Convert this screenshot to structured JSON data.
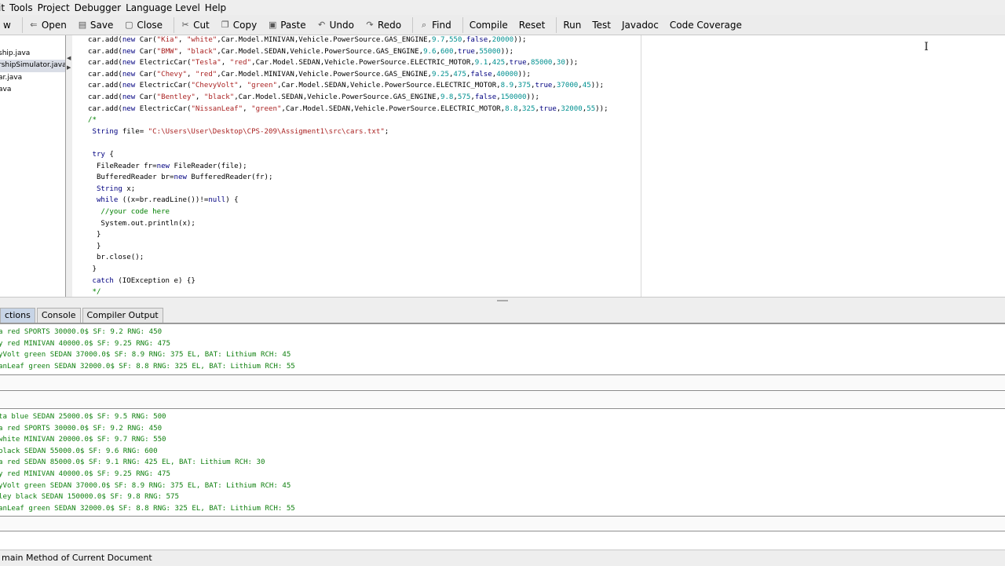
{
  "menubar": [
    "it",
    "Tools",
    "Project",
    "Debugger",
    "Language Level",
    "Help"
  ],
  "toolbar": [
    {
      "icon": "",
      "label": "w"
    },
    {
      "icon": "open-icon",
      "glyph": "⇐",
      "label": "Open"
    },
    {
      "icon": "save-icon",
      "glyph": "▤",
      "label": "Save"
    },
    {
      "icon": "close-file-icon",
      "glyph": "▢",
      "label": "Close"
    },
    {
      "icon": "cut-icon",
      "glyph": "✂",
      "label": "Cut"
    },
    {
      "icon": "copy-icon",
      "glyph": "❐",
      "label": "Copy"
    },
    {
      "icon": "paste-icon",
      "glyph": "▣",
      "label": "Paste"
    },
    {
      "icon": "undo-icon",
      "glyph": "↶",
      "label": "Undo"
    },
    {
      "icon": "redo-icon",
      "glyph": "↷",
      "label": "Redo"
    },
    {
      "icon": "find-icon",
      "glyph": "⌕",
      "label": "Find"
    },
    {
      "icon": "",
      "label": "Compile"
    },
    {
      "icon": "",
      "label": "Reset"
    },
    {
      "icon": "",
      "label": "Run"
    },
    {
      "icon": "",
      "label": "Test"
    },
    {
      "icon": "",
      "label": "Javadoc"
    },
    {
      "icon": "",
      "label": "Code Coverage"
    }
  ],
  "files": [
    {
      "name": "",
      "selected": false
    },
    {
      "name": "ship.java",
      "selected": false
    },
    {
      "name": "rshipSimulator.java",
      "selected": true
    },
    {
      "name": "ar.java",
      "selected": false
    },
    {
      "name": "ava",
      "selected": false
    }
  ],
  "code_lines": [
    "car.add(new Car(\"Kia\", \"white\",Car.Model.MINIVAN,Vehicle.PowerSource.GAS_ENGINE,9.7,550,false,20000));",
    "car.add(new Car(\"BMW\", \"black\",Car.Model.SEDAN,Vehicle.PowerSource.GAS_ENGINE,9.6,600,true,55000));",
    "car.add(new ElectricCar(\"Tesla\", \"red\",Car.Model.SEDAN,Vehicle.PowerSource.ELECTRIC_MOTOR,9.1,425,true,85000,30));",
    "car.add(new Car(\"Chevy\", \"red\",Car.Model.MINIVAN,Vehicle.PowerSource.GAS_ENGINE,9.25,475,false,40000));",
    "car.add(new ElectricCar(\"ChevyVolt\", \"green\",Car.Model.SEDAN,Vehicle.PowerSource.ELECTRIC_MOTOR,8.9,375,true,37000,45));",
    "car.add(new Car(\"Bentley\", \"black\",Car.Model.SEDAN,Vehicle.PowerSource.GAS_ENGINE,9.8,575,false,150000));",
    "car.add(new ElectricCar(\"NissanLeaf\", \"green\",Car.Model.SEDAN,Vehicle.PowerSource.ELECTRIC_MOTOR,8.8,325,true,32000,55));",
    "/*",
    " String file= \"C:\\Users\\User\\Desktop\\CPS-209\\Assigment1\\src\\cars.txt\";",
    "",
    " try {",
    "  FileReader fr=new FileReader(file);",
    "  BufferedReader br=new BufferedReader(fr);",
    "  String x;",
    "  while ((x=br.readLine())!=null) {",
    "   //your code here",
    "   System.out.println(x);",
    "  }",
    "  }",
    "  br.close();",
    " }",
    " catch (IOException e) {}",
    " */"
  ],
  "tabs": [
    "ctions",
    "Console",
    "Compiler Output"
  ],
  "output_top": [
    "a red SPORTS 30000.0$ SF: 9.2 RNG: 450",
    "y red MINIVAN 40000.0$ SF: 9.25 RNG: 475",
    "yVolt green SEDAN 37000.0$ SF: 8.9 RNG: 375 EL, BAT: Lithium RCH: 45",
    "anLeaf green SEDAN 32000.0$ SF: 8.8 RNG: 325 EL, BAT: Lithium RCH: 55"
  ],
  "output_bottom": [
    "ta blue SEDAN 25000.0$ SF: 9.5 RNG: 500",
    "a red SPORTS 30000.0$ SF: 9.2 RNG: 450",
    "white MINIVAN 20000.0$ SF: 9.7 RNG: 550",
    "black SEDAN 55000.0$ SF: 9.6 RNG: 600",
    "a red SEDAN 85000.0$ SF: 9.1 RNG: 425 EL, BAT: Lithium RCH: 30",
    "y red MINIVAN 40000.0$ SF: 9.25 RNG: 475",
    "yVolt green SEDAN 37000.0$ SF: 8.9 RNG: 375 EL, BAT: Lithium RCH: 45",
    "ley black SEDAN 150000.0$ SF: 9.8 RNG: 575",
    "anLeaf green SEDAN 32000.0$ SF: 8.8 RNG: 325 EL, BAT: Lithium RCH: 55"
  ],
  "status": "main Method of Current Document"
}
